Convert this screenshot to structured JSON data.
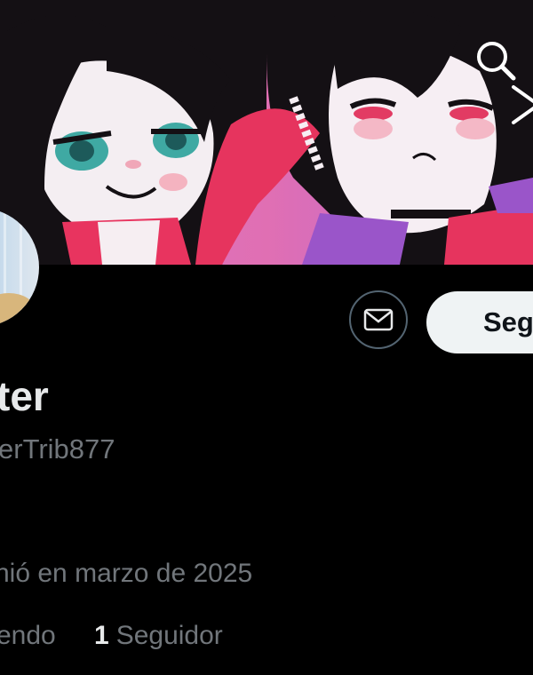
{
  "profile": {
    "display_name_visible": "ter",
    "handle_visible": "erTrib877",
    "joined_visible": "nió en marzo de 2025",
    "following_label_visible": "endo",
    "followers_count": "1",
    "followers_label": "Seguidor"
  },
  "actions": {
    "follow_label_visible": "Seg",
    "message_icon": "mail-icon",
    "search_icon": "search-icon",
    "more_icon": "more-icon"
  },
  "colors": {
    "background": "#000000",
    "primary_text": "#e7e9ea",
    "secondary_text": "#71767b",
    "follow_button_bg": "#eff3f4",
    "follow_button_text": "#0f1419",
    "outline": "#536471"
  }
}
